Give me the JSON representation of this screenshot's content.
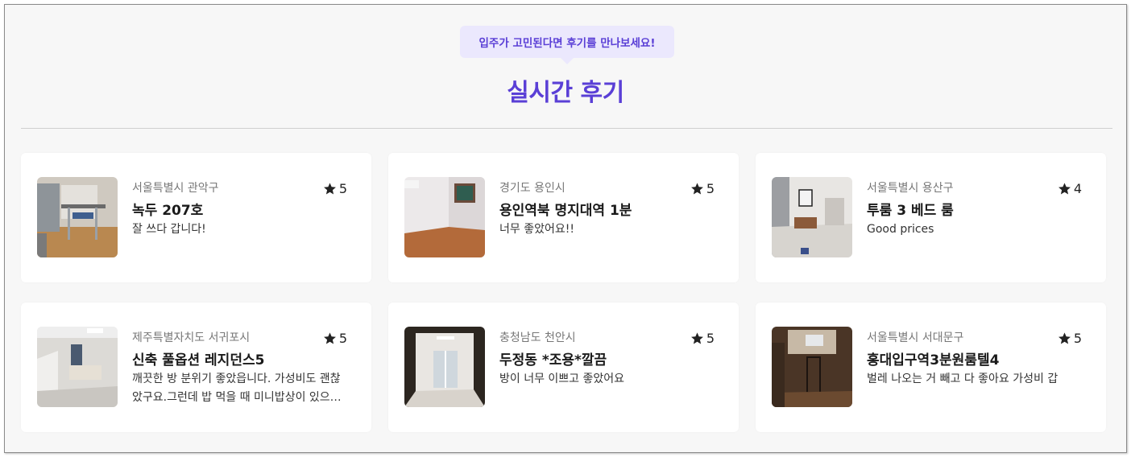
{
  "header": {
    "bubble_text": "입주가 고민된다면 후기를 만나보세요!",
    "title": "실시간 후기"
  },
  "colors": {
    "accent": "#5a3fd6",
    "bubble_bg": "#ebe8fd",
    "page_bg": "#f7f7f7",
    "card_bg": "#ffffff"
  },
  "reviews": [
    {
      "region": "서울특별시 관악구",
      "rating": "5",
      "title": "녹두 207호",
      "text": "잘 쓰다 갑니다!",
      "photo": "room-photo-desk-chair"
    },
    {
      "region": "경기도 용인시",
      "rating": "5",
      "title": "용인역북 명지대역 1분",
      "text": "너무 좋았어요!!",
      "photo": "room-photo-empty-room"
    },
    {
      "region": "서울특별시 용산구",
      "rating": "4",
      "title": "투룸 3 베드 룸",
      "text": "Good prices",
      "photo": "room-photo-living-room"
    },
    {
      "region": "제주특별자치도 서귀포시",
      "rating": "5",
      "title": "신축 풀옵션 레지던스5",
      "text": "깨끗한 방 분위기 좋았읍니다. 가성비도 괜찮았구요.그런데 밥 먹을 때 미니밥상이 있으면 좋겠어요",
      "photo": "room-photo-bedroom"
    },
    {
      "region": "충청남도 천안시",
      "rating": "5",
      "title": "두정동 *조용*깔끔",
      "text": "방이 너무 이쁘고 좋았어요",
      "photo": "room-photo-bright-room"
    },
    {
      "region": "서울특별시 서대문구",
      "rating": "5",
      "title": "홍대입구역3분원룸텔4",
      "text": "벌레 나오는 거 빼고 다 좋아요 가성비 갑",
      "photo": "room-photo-window-room"
    }
  ]
}
